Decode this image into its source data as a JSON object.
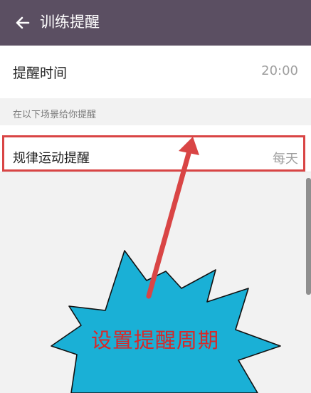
{
  "header": {
    "title": "训练提醒",
    "back_icon": "arrow-left-icon"
  },
  "reminder_time": {
    "label": "提醒时间",
    "value": "20:00"
  },
  "section": {
    "caption": "在以下场景给你提醒"
  },
  "regular_exercise": {
    "label": "规律运动提醒",
    "value": "每天"
  },
  "annotation": {
    "callout_text": "设置提醒周期",
    "callout_color": "#1ab0d6",
    "arrow_color": "#d94545"
  },
  "colors": {
    "app_bar": "#5b4f62",
    "background": "#f2f2f2",
    "highlight": "#d94545"
  }
}
